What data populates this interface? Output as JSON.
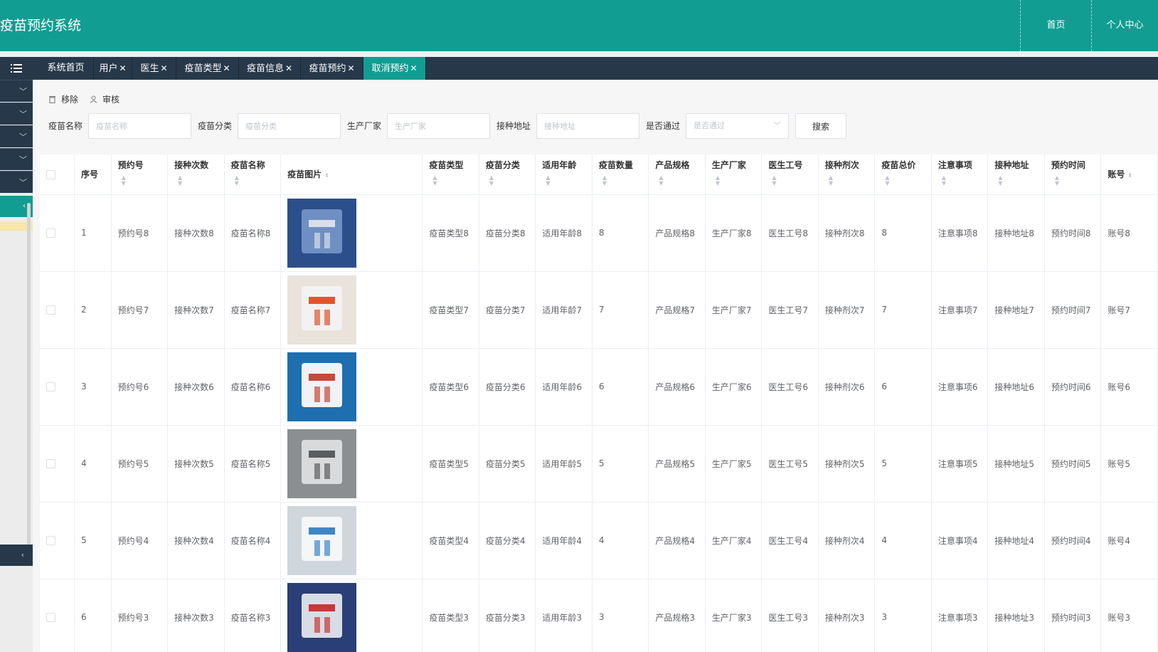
{
  "app": {
    "title": "疫苗预约系统",
    "nav": {
      "home": "首页",
      "profile": "个人中心"
    },
    "accent_color": "#129d92",
    "dark_color": "#27384a"
  },
  "sidebar": {
    "toggle_icon": "list-icon",
    "items_icon": "chevron-down-icon"
  },
  "tabs": [
    {
      "label": "系统首页",
      "closable": false
    },
    {
      "label": "用户",
      "closable": true
    },
    {
      "label": "医生",
      "closable": true
    },
    {
      "label": "疫苗类型",
      "closable": true
    },
    {
      "label": "疫苗信息",
      "closable": true
    },
    {
      "label": "疫苗预约",
      "closable": true
    },
    {
      "label": "取消预约",
      "closable": true,
      "active": true
    }
  ],
  "tab_close_glyph": "✕",
  "actions": {
    "remove": "移除",
    "review": "审核"
  },
  "search": {
    "name_label": "疫苗名称",
    "name_placeholder": "疫苗名称",
    "category_label": "疫苗分类",
    "category_placeholder": "疫苗分类",
    "maker_label": "生产厂家",
    "maker_placeholder": "生产厂家",
    "address_label": "接种地址",
    "address_placeholder": "接种地址",
    "passed_label": "是否通过",
    "passed_placeholder": "是否通过",
    "button": "搜索"
  },
  "table": {
    "columns": [
      "序号",
      "预约号",
      "接种次数",
      "疫苗名称",
      "疫苗图片",
      "疫苗类型",
      "疫苗分类",
      "适用年龄",
      "疫苗数量",
      "产品规格",
      "生产厂家",
      "医生工号",
      "接种剂次",
      "疫苗总价",
      "注意事项",
      "接种地址",
      "预约时间",
      "账号"
    ],
    "rows": [
      [
        "1",
        "预约号8",
        "接种次数8",
        "疫苗名称8",
        "",
        "疫苗类型8",
        "疫苗分类8",
        "适用年龄8",
        "8",
        "产品规格8",
        "生产厂家8",
        "医生工号8",
        "接种剂次8",
        "8",
        "注意事项8",
        "接种地址8",
        "预约时间8",
        "账号8"
      ],
      [
        "2",
        "预约号7",
        "接种次数7",
        "疫苗名称7",
        "",
        "疫苗类型7",
        "疫苗分类7",
        "适用年龄7",
        "7",
        "产品规格7",
        "生产厂家7",
        "医生工号7",
        "接种剂次7",
        "7",
        "注意事项7",
        "接种地址7",
        "预约时间7",
        "账号7"
      ],
      [
        "3",
        "预约号6",
        "接种次数6",
        "疫苗名称6",
        "",
        "疫苗类型6",
        "疫苗分类6",
        "适用年龄6",
        "6",
        "产品规格6",
        "生产厂家6",
        "医生工号6",
        "接种剂次6",
        "6",
        "注意事项6",
        "接种地址6",
        "预约时间6",
        "账号6"
      ],
      [
        "4",
        "预约号5",
        "接种次数5",
        "疫苗名称5",
        "",
        "疫苗类型5",
        "疫苗分类5",
        "适用年龄5",
        "5",
        "产品规格5",
        "生产厂家5",
        "医生工号5",
        "接种剂次5",
        "5",
        "注意事项5",
        "接种地址5",
        "预约时间5",
        "账号5"
      ],
      [
        "5",
        "预约号4",
        "接种次数4",
        "疫苗名称4",
        "",
        "疫苗类型4",
        "疫苗分类4",
        "适用年龄4",
        "4",
        "产品规格4",
        "生产厂家4",
        "医生工号4",
        "接种剂次4",
        "4",
        "注意事项4",
        "接种地址4",
        "预约时间4",
        "账号4"
      ],
      [
        "6",
        "预约号3",
        "接种次数3",
        "疫苗名称3",
        "",
        "疫苗类型3",
        "疫苗分类3",
        "适用年龄3",
        "3",
        "产品规格3",
        "生产厂家3",
        "医生工号3",
        "接种剂次3",
        "3",
        "注意事项3",
        "接种地址3",
        "预约时间3",
        "账号3"
      ]
    ]
  }
}
